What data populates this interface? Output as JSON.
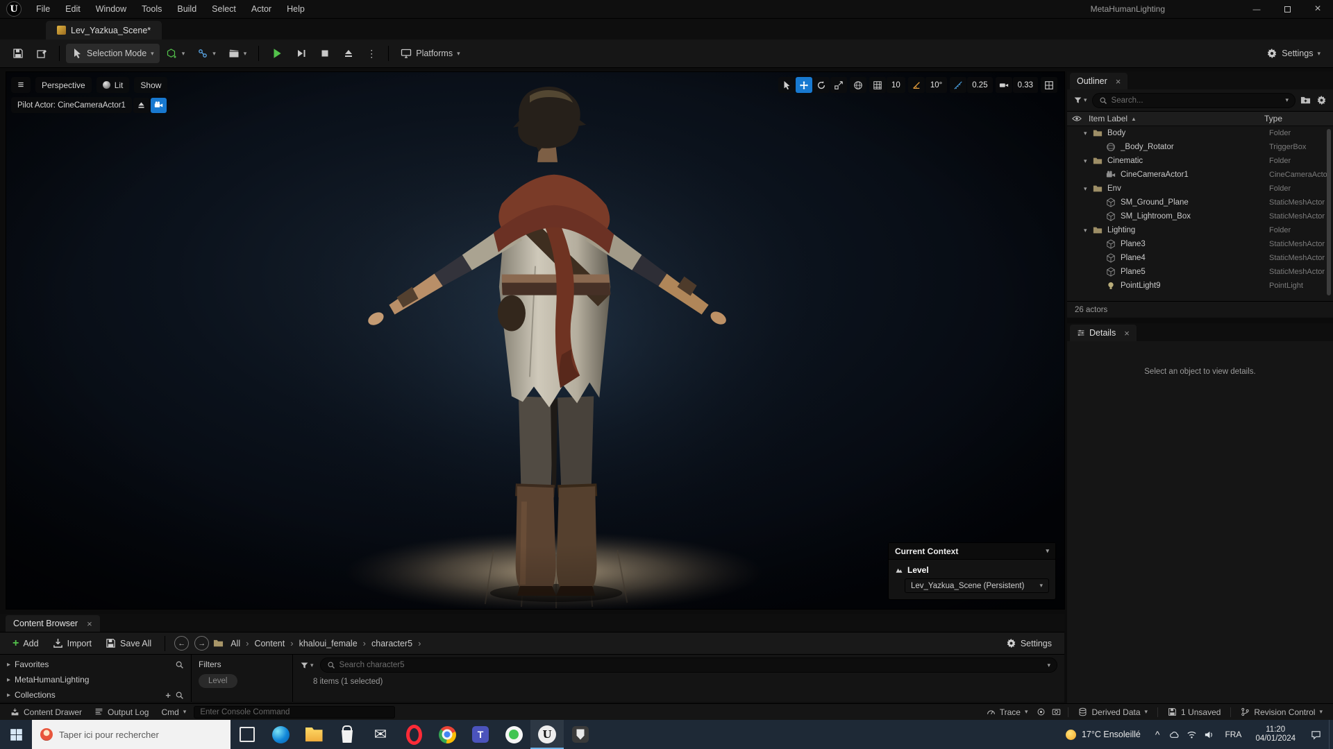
{
  "colors": {
    "accent_blue": "#1879d0",
    "angle_orange": "#e09a3a",
    "play_green": "#53c24b",
    "folder_tan": "#9d8e66"
  },
  "window": {
    "app_title": "MetaHumanLighting",
    "menu_items": [
      "File",
      "Edit",
      "Window",
      "Tools",
      "Build",
      "Select",
      "Actor",
      "Help"
    ],
    "level_tab_label": "Lev_Yazkua_Scene*"
  },
  "toolbar": {
    "selection_mode_label": "Selection Mode",
    "platforms_label": "Platforms",
    "settings_label": "Settings"
  },
  "viewport": {
    "perspective_label": "Perspective",
    "lit_label": "Lit",
    "show_label": "Show",
    "pilot_label": "Pilot Actor: CineCameraActor1",
    "snap_grid_value": "10",
    "snap_angle_value": "10°",
    "snap_scale_value": "0.25",
    "camera_speed_value": "0.33",
    "context_overlay": {
      "title": "Current Context",
      "level_label": "Level",
      "level_name": "Lev_Yazkua_Scene (Persistent)"
    }
  },
  "outliner": {
    "tab_title": "Outliner",
    "search_placeholder": "Search...",
    "col_item_label": "Item Label",
    "col_type": "Type",
    "rows": [
      {
        "label": "Body",
        "type": "Folder",
        "icon": "folder",
        "indent": 1
      },
      {
        "label": "_Body_Rotator",
        "type": "TriggerBox",
        "icon": "trigger",
        "indent": 2
      },
      {
        "label": "Cinematic",
        "type": "Folder",
        "icon": "folder",
        "indent": 1
      },
      {
        "label": "CineCameraActor1",
        "type": "CineCameraActor",
        "icon": "camera",
        "indent": 2
      },
      {
        "label": "Env",
        "type": "Folder",
        "icon": "folder",
        "indent": 1
      },
      {
        "label": "SM_Ground_Plane",
        "type": "StaticMeshActor",
        "icon": "mesh",
        "indent": 2
      },
      {
        "label": "SM_Lightroom_Box",
        "type": "StaticMeshActor",
        "icon": "mesh",
        "indent": 2
      },
      {
        "label": "Lighting",
        "type": "Folder",
        "icon": "folder",
        "indent": 1
      },
      {
        "label": "Plane3",
        "type": "StaticMeshActor",
        "icon": "mesh",
        "indent": 2
      },
      {
        "label": "Plane4",
        "type": "StaticMeshActor",
        "icon": "mesh",
        "indent": 2
      },
      {
        "label": "Plane5",
        "type": "StaticMeshActor",
        "icon": "mesh",
        "indent": 2
      },
      {
        "label": "PointLight9",
        "type": "PointLight",
        "icon": "light",
        "indent": 2
      }
    ],
    "footer_text": "26 actors"
  },
  "details": {
    "tab_title": "Details",
    "empty_message": "Select an object to view details."
  },
  "content_browser": {
    "tab_title": "Content Browser",
    "add_label": "Add",
    "import_label": "Import",
    "save_all_label": "Save All",
    "breadcrumbs": [
      "All",
      "Content",
      "khaloui_female",
      "character5"
    ],
    "settings_label": "Settings",
    "favorites_label": "Favorites",
    "paths_root_label": "MetaHumanLighting",
    "collections_label": "Collections",
    "filters_label": "Filters",
    "filter_chip_label": "Level",
    "search_placeholder": "Search character5",
    "status_text": "8 items (1 selected)"
  },
  "status_bar": {
    "content_drawer_label": "Content Drawer",
    "output_log_label": "Output Log",
    "cmd_label": "Cmd",
    "console_placeholder": "Enter Console Command",
    "trace_label": "Trace",
    "derived_data_label": "Derived Data",
    "unsaved_label": "1 Unsaved",
    "revision_control_label": "Revision Control"
  },
  "taskbar": {
    "search_placeholder": "Taper ici pour rechercher",
    "apps": [
      "task-view",
      "edge",
      "file-explorer",
      "store",
      "mail",
      "opera",
      "chrome",
      "teams",
      "whatsapp",
      "unreal-editor",
      "epic-games"
    ],
    "tray_icons": [
      "onedrive-cloud",
      "network-wifi",
      "volume"
    ],
    "weather_text": "17°C Ensoleillé",
    "language_label": "FRA",
    "time_text": "11:20",
    "date_text": "04/01/2024"
  }
}
